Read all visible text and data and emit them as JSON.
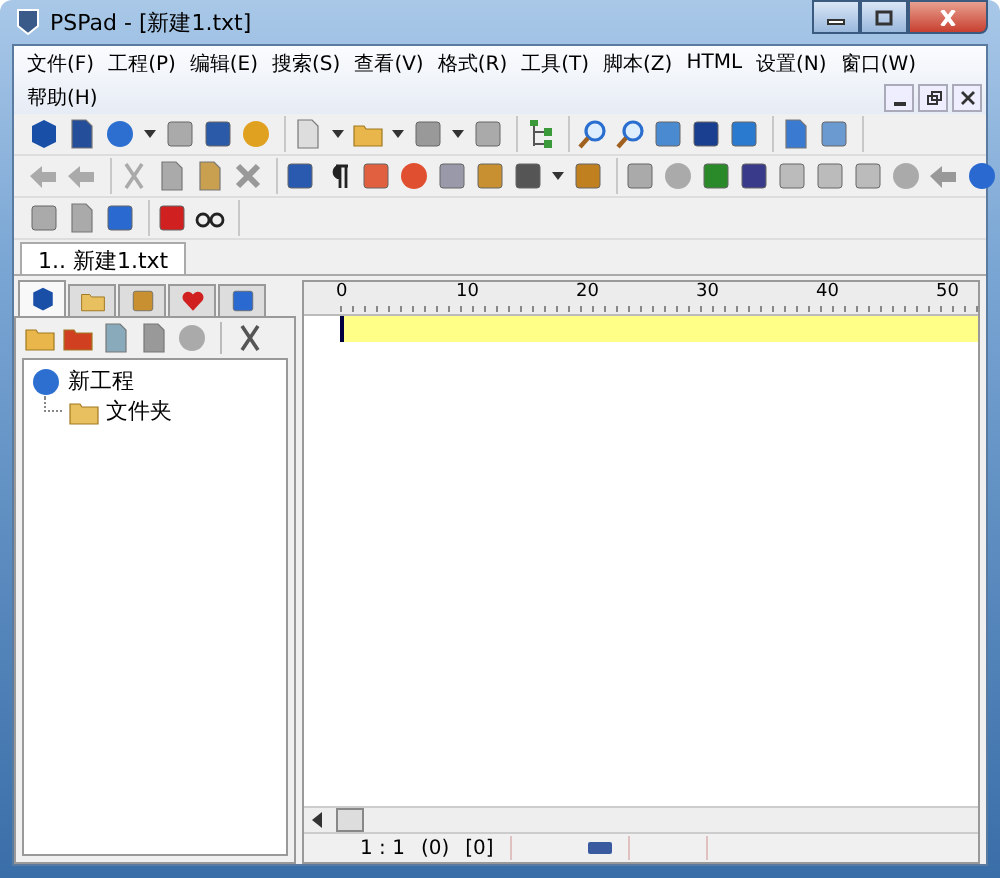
{
  "window": {
    "title": "PSPad - [新建1.txt]"
  },
  "menu": [
    "文件(F)",
    "工程(P)",
    "编辑(E)",
    "搜索(S)",
    "查看(V)",
    "格式(R)",
    "工具(T)",
    "脚本(Z)",
    "HTML",
    "设置(N)",
    "窗口(W)",
    "帮助(H)"
  ],
  "document_tabs": [
    {
      "label": "1.. 新建1.txt",
      "selected": true
    }
  ],
  "panel_tabs": [
    {
      "selected": true
    },
    {
      "selected": false
    },
    {
      "selected": false
    },
    {
      "selected": false
    },
    {
      "selected": false
    }
  ],
  "project_tree": [
    {
      "label": "新工程",
      "children": [
        {
          "label": "文件夹"
        }
      ]
    }
  ],
  "ruler": {
    "labels": [
      "0",
      "10",
      "20",
      "30",
      "40",
      "50"
    ]
  },
  "status_bar": {
    "segments": [
      "1 : 1",
      "(0)",
      "[0]"
    ]
  }
}
